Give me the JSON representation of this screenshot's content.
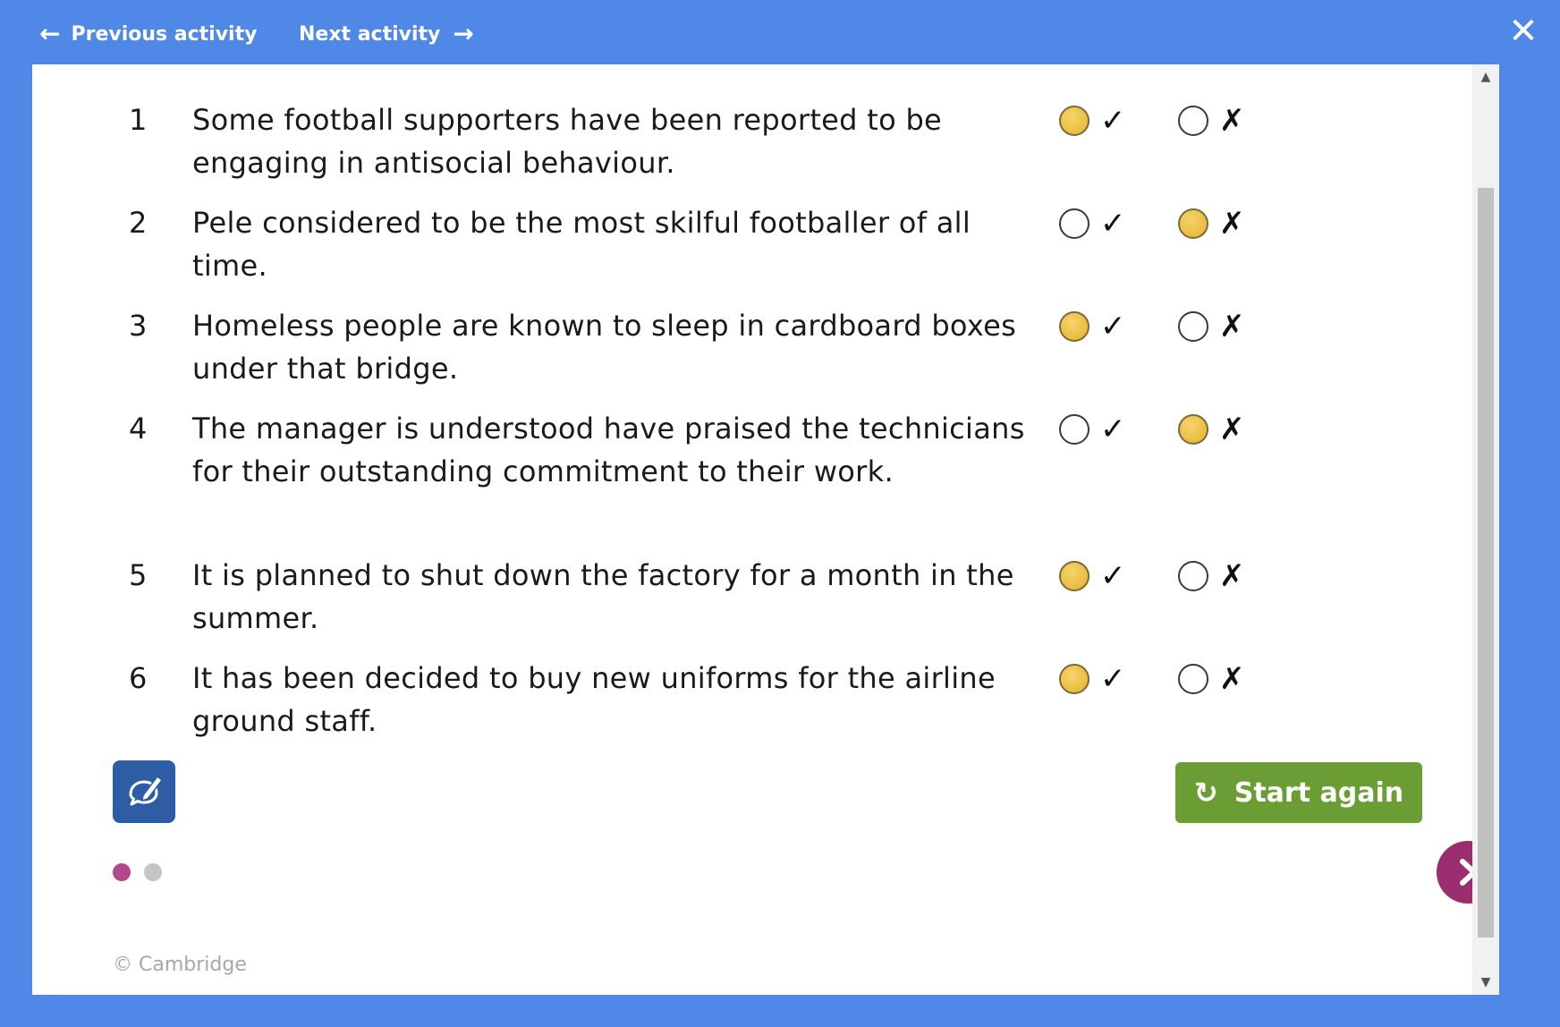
{
  "header": {
    "prev_label": "Previous activity",
    "next_label": "Next activity",
    "close_glyph": "✕"
  },
  "questions": [
    {
      "num": "1",
      "text": "Some football supporters have been reported to be engaging in antisocial behaviour.",
      "answer": "true"
    },
    {
      "num": "2",
      "text": "Pele considered to be the most skilful footballer of all time.",
      "answer": "false"
    },
    {
      "num": "3",
      "text": "Homeless people are known to sleep in cardboard boxes under that bridge.",
      "answer": "true"
    },
    {
      "num": "4",
      "text": "The manager is understood have praised the technicians for their outstanding commitment to their work.",
      "answer": "false"
    },
    {
      "num": "5",
      "text": "It is planned to shut down the factory for a month in the summer.",
      "answer": "true"
    },
    {
      "num": "6",
      "text": "It has been decided to buy new uniforms for the airline ground staff.",
      "answer": "true"
    }
  ],
  "marks": {
    "true_glyph": "✓",
    "false_glyph": "✗"
  },
  "controls": {
    "start_again_label": "Start again",
    "start_again_icon": "refresh-icon",
    "pen_tool_icon": "pen-comment-icon",
    "next_page_icon": "chevron-right-icon"
  },
  "pagination": {
    "pages": 2,
    "current": 1
  },
  "footer": {
    "copyright": "© Cambridge"
  },
  "colors": {
    "frame": "#4f88e6",
    "selected_radio": "#e9bd3f",
    "start_again": "#6a9d33",
    "tool_button": "#2e5da6",
    "active_dot": "#b3488f",
    "next_circle": "#9b2e6e"
  }
}
